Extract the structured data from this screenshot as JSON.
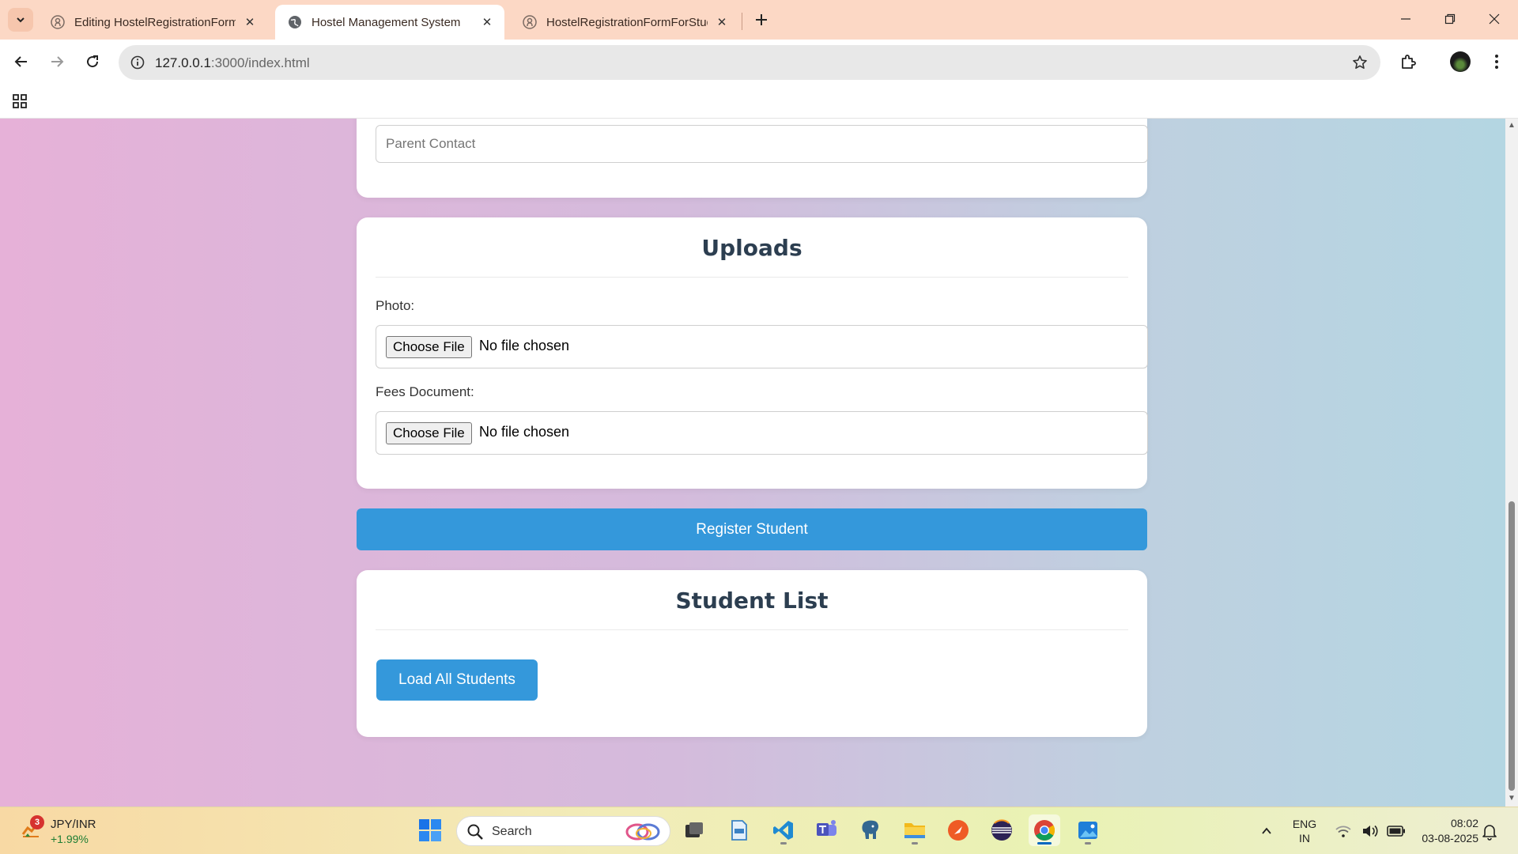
{
  "browser": {
    "tabs": [
      {
        "title": "Editing HostelRegistrationForm",
        "active": false,
        "icon": "github-icon"
      },
      {
        "title": "Hostel Management System",
        "active": true,
        "icon": "globe-icon"
      },
      {
        "title": "HostelRegistrationFormForStud",
        "active": false,
        "icon": "github-icon"
      }
    ],
    "url_host": "127.0.0.1",
    "url_path": ":3000/index.html"
  },
  "page": {
    "parent_contact_placeholder": "Parent Contact",
    "uploads": {
      "title": "Uploads",
      "photo_label": "Photo:",
      "fees_label": "Fees Document:",
      "choose_file": "Choose File",
      "no_file": "No file chosen"
    },
    "register_button": "Register Student",
    "student_list": {
      "title": "Student List",
      "load_button": "Load All Students"
    }
  },
  "taskbar": {
    "widget": {
      "title": "JPY/INR",
      "change": "+1.99%",
      "badge": "3"
    },
    "search_placeholder": "Search",
    "pinned": [
      "task-view-icon",
      "pdf-editor-icon",
      "vscode-icon",
      "teams-icon",
      "postgresql-icon",
      "file-explorer-icon",
      "postman-icon",
      "eclipse-icon",
      "chrome-icon",
      "photos-icon"
    ],
    "lang_top": "ENG",
    "lang_bottom": "IN",
    "time": "08:02",
    "date": "03-08-2025"
  },
  "colors": {
    "accent": "#3498db",
    "heading": "#2c3e50",
    "tabstrip": "#fcd8c5"
  }
}
